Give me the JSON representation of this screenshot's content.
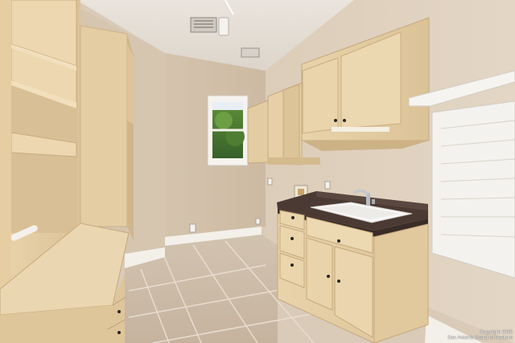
{
  "photo": {
    "kind": "laundry-room interior photograph",
    "colors": {
      "wall": "#d8c8b3",
      "ceiling": "#e6e1da",
      "cabinet": "#e6cfa4",
      "countertop": "#4b3a33",
      "floor": "#cdbda9",
      "trim": "#f2efe9"
    }
  },
  "watermark": {
    "line1": "Copyright 2025",
    "line2": "San Antonio Board of Realtors"
  }
}
